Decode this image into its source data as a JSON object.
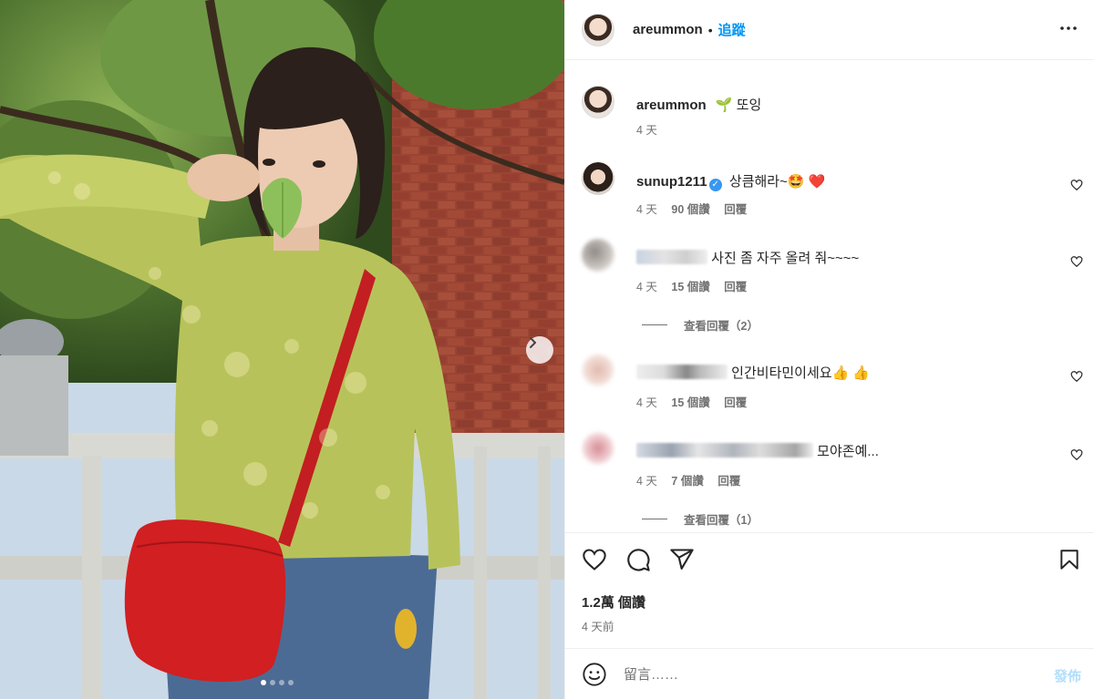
{
  "post": {
    "username": "areummon",
    "follow_label": "追蹤",
    "separator": "•",
    "caption_icon": "seedling-emoji",
    "caption_emoji": "🌱",
    "caption_text": "또잉",
    "caption_time": "4 天",
    "carousel": {
      "slides": 4,
      "active_index": 0
    }
  },
  "comments": [
    {
      "username": "sunup1211",
      "verified": true,
      "text": "상큼해라~🤩",
      "heart_emoji": "❤️",
      "time": "4 天",
      "likes": "90 個讚",
      "reply": "回覆"
    },
    {
      "username": "",
      "text": "사진 좀 자주 올려 줘~~~~",
      "time": "4 天",
      "likes": "15 個讚",
      "reply": "回覆",
      "view_replies": "查看回覆（2）"
    },
    {
      "username": "",
      "text": "인간비타민이세요👍 👍",
      "time": "4 天",
      "likes": "15 個讚",
      "reply": "回覆"
    },
    {
      "username": "",
      "text": "모야존예...",
      "time": "4 天",
      "likes": "7 個讚",
      "reply": "回覆",
      "view_replies": "查看回覆（1）"
    }
  ],
  "stats": {
    "views": "1.2萬 個讚",
    "posted": "4 天前"
  },
  "composer": {
    "placeholder": "留言……",
    "post_label": "發佈"
  },
  "colors": {
    "accent": "#0095f6",
    "post_disabled": "#b2dffc",
    "muted": "#737373",
    "like_red": "#ed4956"
  }
}
